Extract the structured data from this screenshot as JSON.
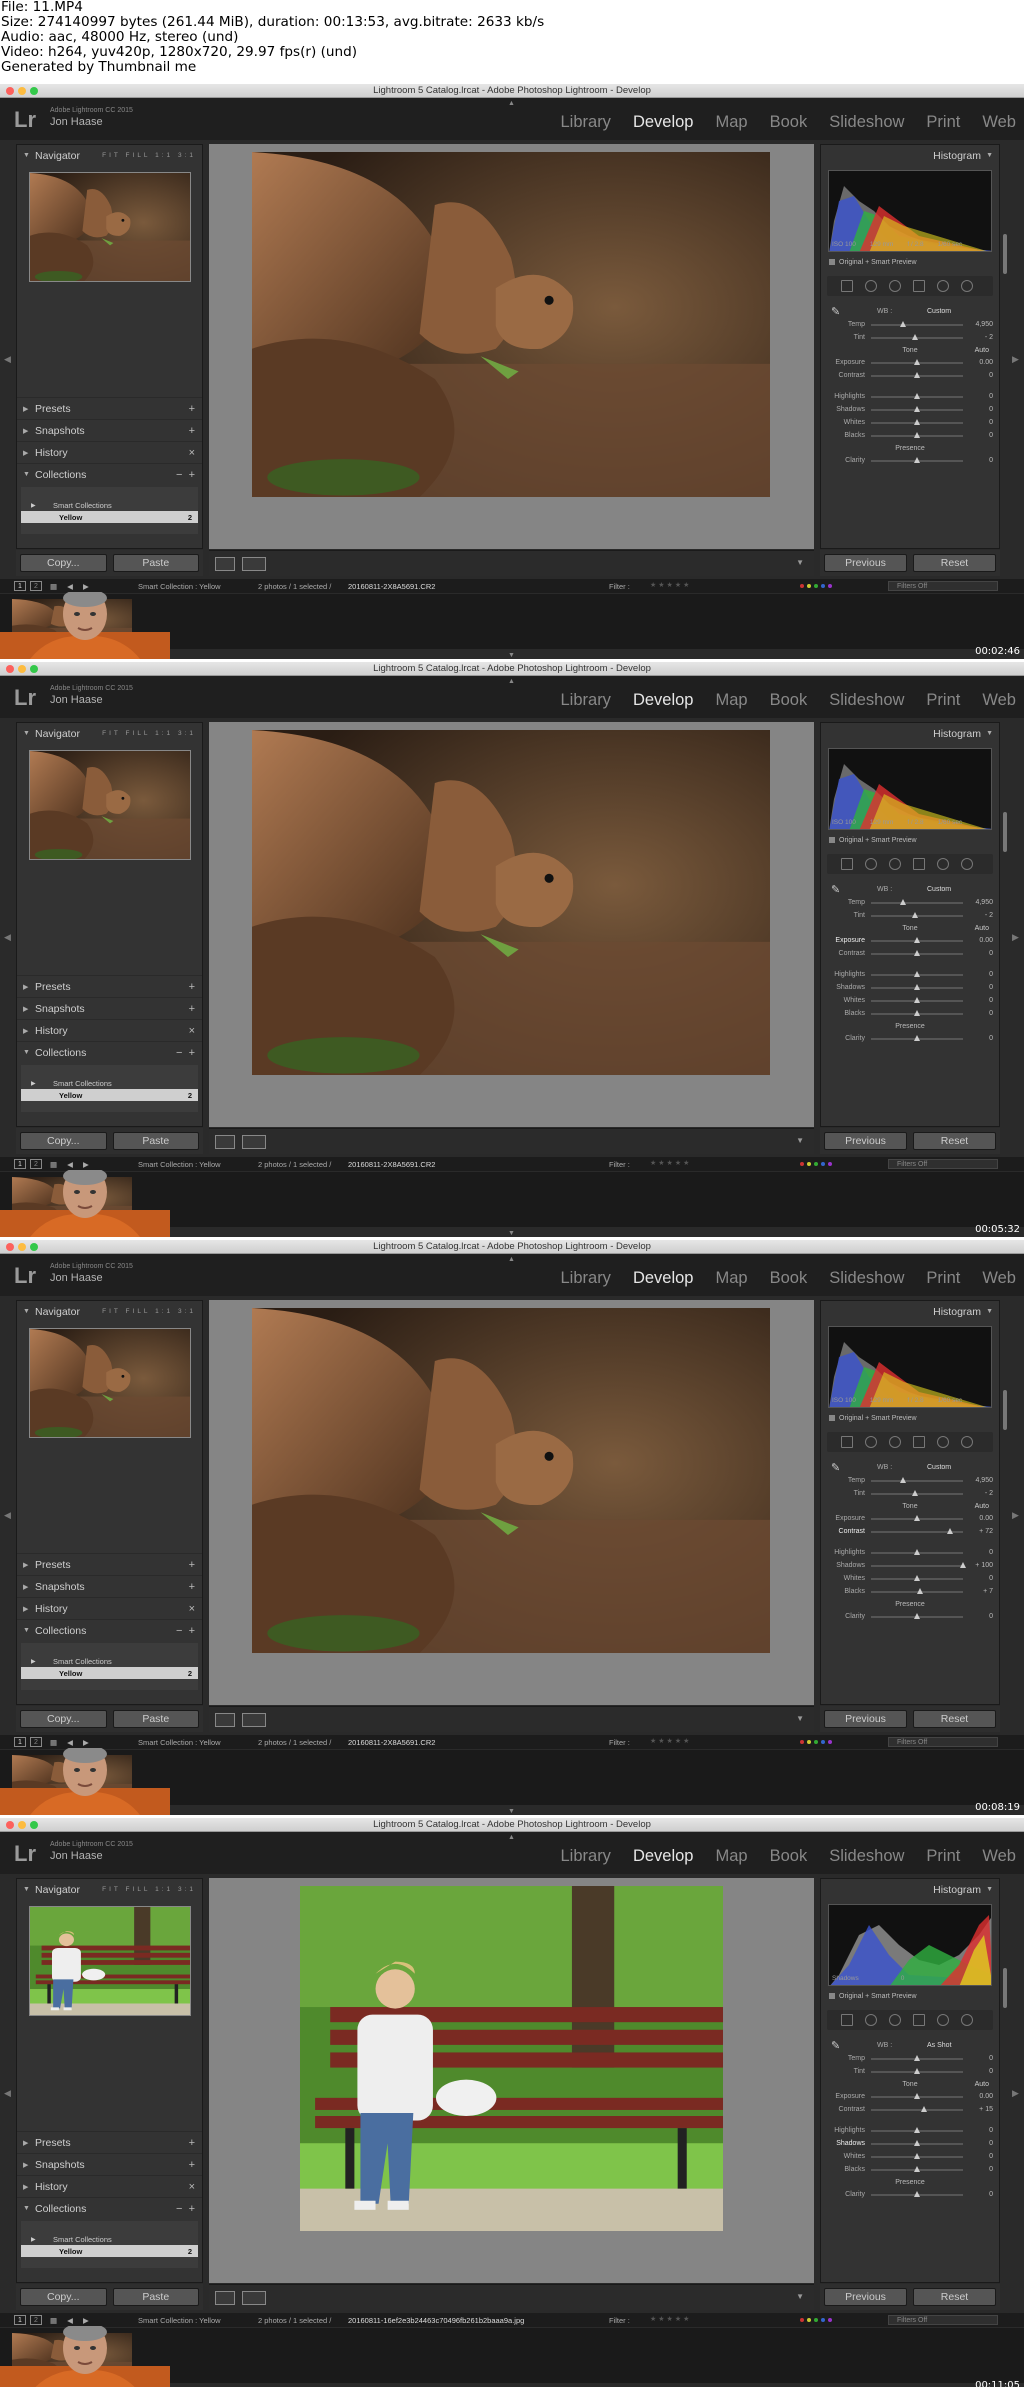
{
  "header": {
    "lines": [
      "File: 11.MP4",
      "Size: 274140997 bytes (261.44 MiB), duration: 00:13:53, avg.bitrate: 2633 kb/s",
      "Audio: aac, 48000 Hz, stereo (und)",
      "Video: h264, yuv420p, 1280x720, 29.97 fps(r) (und)",
      "Generated by Thumbnail me"
    ]
  },
  "window": {
    "title": "Lightroom 5 Catalog.lrcat - Adobe Photoshop Lightroom - Develop"
  },
  "identity": {
    "logo": "Lr",
    "edition": "Adobe Lightroom CC 2015",
    "user": "Jon Haase"
  },
  "modules": [
    {
      "label": "Library",
      "active": false
    },
    {
      "label": "Develop",
      "active": true
    },
    {
      "label": "Map",
      "active": false
    },
    {
      "label": "Book",
      "active": false
    },
    {
      "label": "Slideshow",
      "active": false
    },
    {
      "label": "Print",
      "active": false
    },
    {
      "label": "Web",
      "active": false
    }
  ],
  "left": {
    "navigator": "Navigator",
    "nav_options": "FIT FILL 1:1 3:1",
    "presets": "Presets",
    "snapshots": "Snapshots",
    "history": "History",
    "collections": "Collections",
    "smart_collections": "Smart Collections",
    "yellow": "Yellow",
    "yellow_count": "2",
    "copy": "Copy...",
    "paste": "Paste"
  },
  "right": {
    "histogram": "Histogram",
    "original": "Original + Smart Preview",
    "wb": "WB :",
    "tone": "Tone",
    "auto": "Auto",
    "presence": "Presence",
    "previous": "Previous",
    "reset": "Reset",
    "labels": {
      "temp": "Temp",
      "tint": "Tint",
      "exposure": "Exposure",
      "contrast": "Contrast",
      "highlights": "Highlights",
      "shadows": "Shadows",
      "whites": "Whites",
      "blacks": "Blacks",
      "clarity": "Clarity"
    }
  },
  "filmstrip_common": {
    "page1": "1",
    "page2": "2",
    "source": "Smart Collection : Yellow",
    "selection": "2 photos / 1 selected /",
    "filter": "Filter :",
    "filters_off": "Filters Off"
  },
  "frames": [
    {
      "timestamp": "00:02:46",
      "photo": "tortoise",
      "hist_info": [
        "ISO 100",
        "129 mm",
        "f / 2.8",
        "1/60 sec"
      ],
      "wb_value": "Custom",
      "temp": "4,950",
      "tint": "- 2",
      "exposure": "0.00",
      "contrast": "0",
      "highlights": "0",
      "shadows": "0",
      "whites": "0",
      "blacks": "0",
      "clarity": "0",
      "filename": "20160811-2X8A5691.CR2",
      "adjust": {
        "temp": 0.35,
        "tint": 0.48,
        "exposure": 0.5,
        "contrast": 0.5,
        "highlights": 0.5,
        "shadows": 0.5,
        "whites": 0.5,
        "blacks": 0.5,
        "clarity": 0.5
      },
      "active_slider": ""
    },
    {
      "timestamp": "00:05:32",
      "photo": "tortoise",
      "hist_info": [
        "ISO 100",
        "129 mm",
        "f / 2.8",
        "1/60 sec"
      ],
      "wb_value": "Custom",
      "temp": "4,950",
      "tint": "- 2",
      "exposure": "0.00",
      "contrast": "0",
      "highlights": "0",
      "shadows": "0",
      "whites": "0",
      "blacks": "0",
      "clarity": "0",
      "filename": "20160811-2X8A5691.CR2",
      "adjust": {
        "temp": 0.35,
        "tint": 0.48,
        "exposure": 0.5,
        "contrast": 0.5,
        "highlights": 0.5,
        "shadows": 0.5,
        "whites": 0.5,
        "blacks": 0.5,
        "clarity": 0.5
      },
      "active_slider": "exposure"
    },
    {
      "timestamp": "00:08:19",
      "photo": "tortoise",
      "hist_info": [
        "ISO 100",
        "129 mm",
        "f / 2.8",
        "1/60 sec"
      ],
      "wb_value": "Custom",
      "temp": "4,950",
      "tint": "- 2",
      "exposure": "0.00",
      "contrast": "+ 72",
      "highlights": "0",
      "shadows": "+ 100",
      "whites": "0",
      "blacks": "+ 7",
      "clarity": "0",
      "filename": "20160811-2X8A5691.CR2",
      "adjust": {
        "temp": 0.35,
        "tint": 0.48,
        "exposure": 0.5,
        "contrast": 0.86,
        "highlights": 0.5,
        "shadows": 1.0,
        "whites": 0.5,
        "blacks": 0.535,
        "clarity": 0.5
      },
      "active_slider": "contrast"
    },
    {
      "timestamp": "00:11:05",
      "photo": "bench",
      "hist_info": [
        "Shadows",
        "",
        "",
        "0"
      ],
      "wb_value": "As Shot",
      "temp": "0",
      "tint": "0",
      "exposure": "0.00",
      "contrast": "+ 15",
      "highlights": "0",
      "shadows": "0",
      "whites": "0",
      "blacks": "0",
      "clarity": "0",
      "filename": "20160811-16ef2e3b24463c70496fb261b2baaa9a.jpg",
      "adjust": {
        "temp": 0.5,
        "tint": 0.5,
        "exposure": 0.5,
        "contrast": 0.575,
        "highlights": 0.5,
        "shadows": 0.5,
        "whites": 0.5,
        "blacks": 0.5,
        "clarity": 0.5
      },
      "active_slider": "shadows"
    }
  ],
  "colors": {
    "accent_active": "#e6e6e6",
    "panel": "#333333",
    "background": "#2a2a2a",
    "timestamp": "#ffffff"
  }
}
